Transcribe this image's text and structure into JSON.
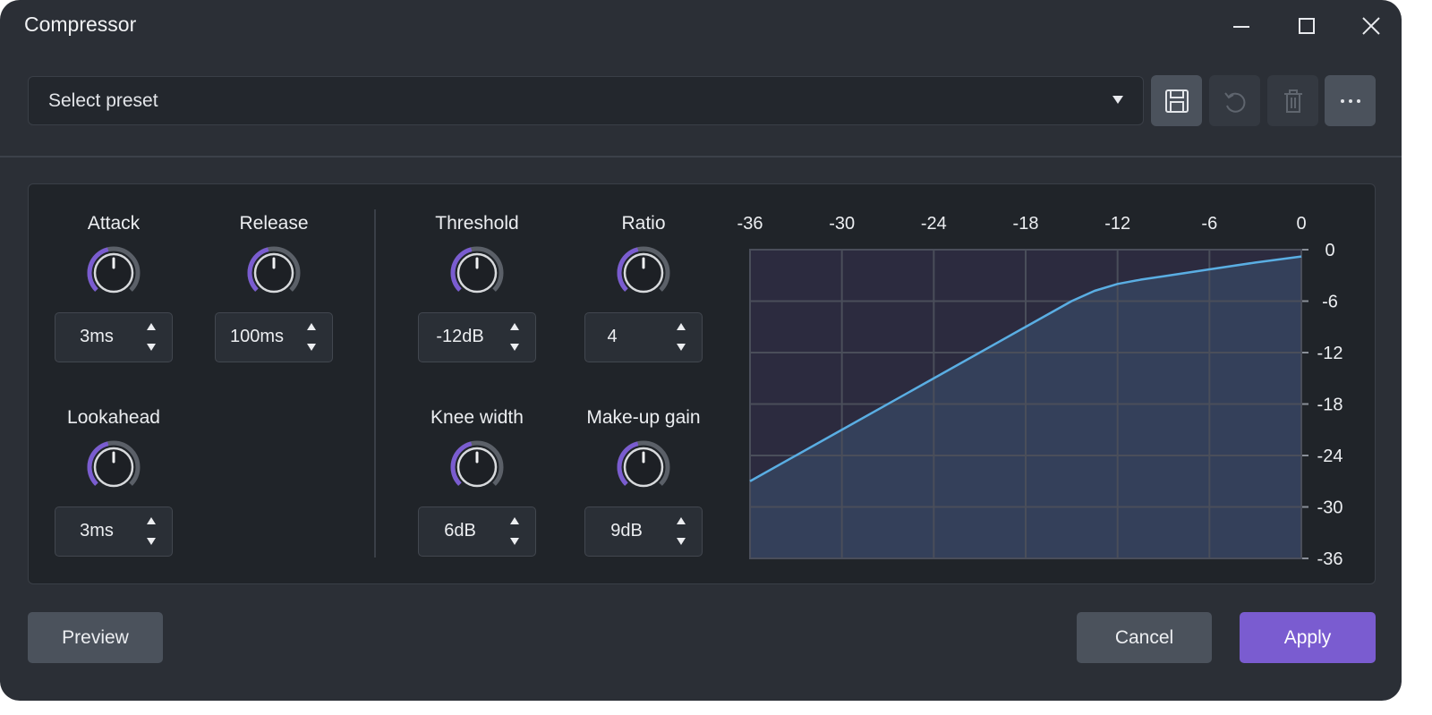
{
  "window": {
    "title": "Compressor"
  },
  "titlebar_icons": [
    "minimize-icon",
    "maximize-icon",
    "close-icon"
  ],
  "preset": {
    "label": "Select preset"
  },
  "toolbar": {
    "icons": [
      "save-icon",
      "undo-icon",
      "trash-icon",
      "more-icon"
    ],
    "undo_enabled": false,
    "delete_enabled": false
  },
  "params": {
    "attack": {
      "label": "Attack",
      "value": "3ms",
      "level": 0.45
    },
    "release": {
      "label": "Release",
      "value": "100ms",
      "level": 0.45
    },
    "lookahead": {
      "label": "Lookahead",
      "value": "3ms",
      "level": 0.45
    },
    "threshold": {
      "label": "Threshold",
      "value": "-12dB",
      "level": 0.45
    },
    "ratio": {
      "label": "Ratio",
      "value": "4",
      "level": 0.45
    },
    "knee": {
      "label": "Knee width",
      "value": "6dB",
      "level": 0.45
    },
    "makeup": {
      "label": "Make-up gain",
      "value": "9dB",
      "level": 0.45
    }
  },
  "chart_data": {
    "type": "line",
    "title": "",
    "xlabel": "",
    "ylabel": "",
    "x_ticks": [
      "-36",
      "-30",
      "-24",
      "-18",
      "-12",
      "-6",
      "0"
    ],
    "y_ticks": [
      "0",
      "-6",
      "-12",
      "-18",
      "-24",
      "-30",
      "-36"
    ],
    "xlim": [
      -36,
      0
    ],
    "ylim": [
      -36,
      0
    ],
    "grid": true,
    "series": [
      {
        "values": [
          [
            -36,
            -27.0
          ],
          [
            -30,
            -21.0
          ],
          [
            -24,
            -15.0
          ],
          [
            -18,
            -9.0
          ],
          [
            -15,
            -6.0
          ],
          [
            -13.5,
            -4.8
          ],
          [
            -12,
            -4.0
          ],
          [
            -10.5,
            -3.5
          ],
          [
            -9,
            -3.1
          ],
          [
            -6,
            -2.3
          ],
          [
            -3,
            -1.5
          ],
          [
            0,
            -0.8
          ]
        ]
      }
    ],
    "colors": {
      "line": "#5aaee3",
      "fill": "#34405a",
      "bg": "#2c2b3f",
      "grid": "#4a4e5a"
    }
  },
  "footer": {
    "preview": "Preview",
    "cancel": "Cancel",
    "apply": "Apply"
  },
  "colors": {
    "accent": "#7a5cd0",
    "knob_track": "#5b6068",
    "window_bg": "#2b2f36"
  }
}
